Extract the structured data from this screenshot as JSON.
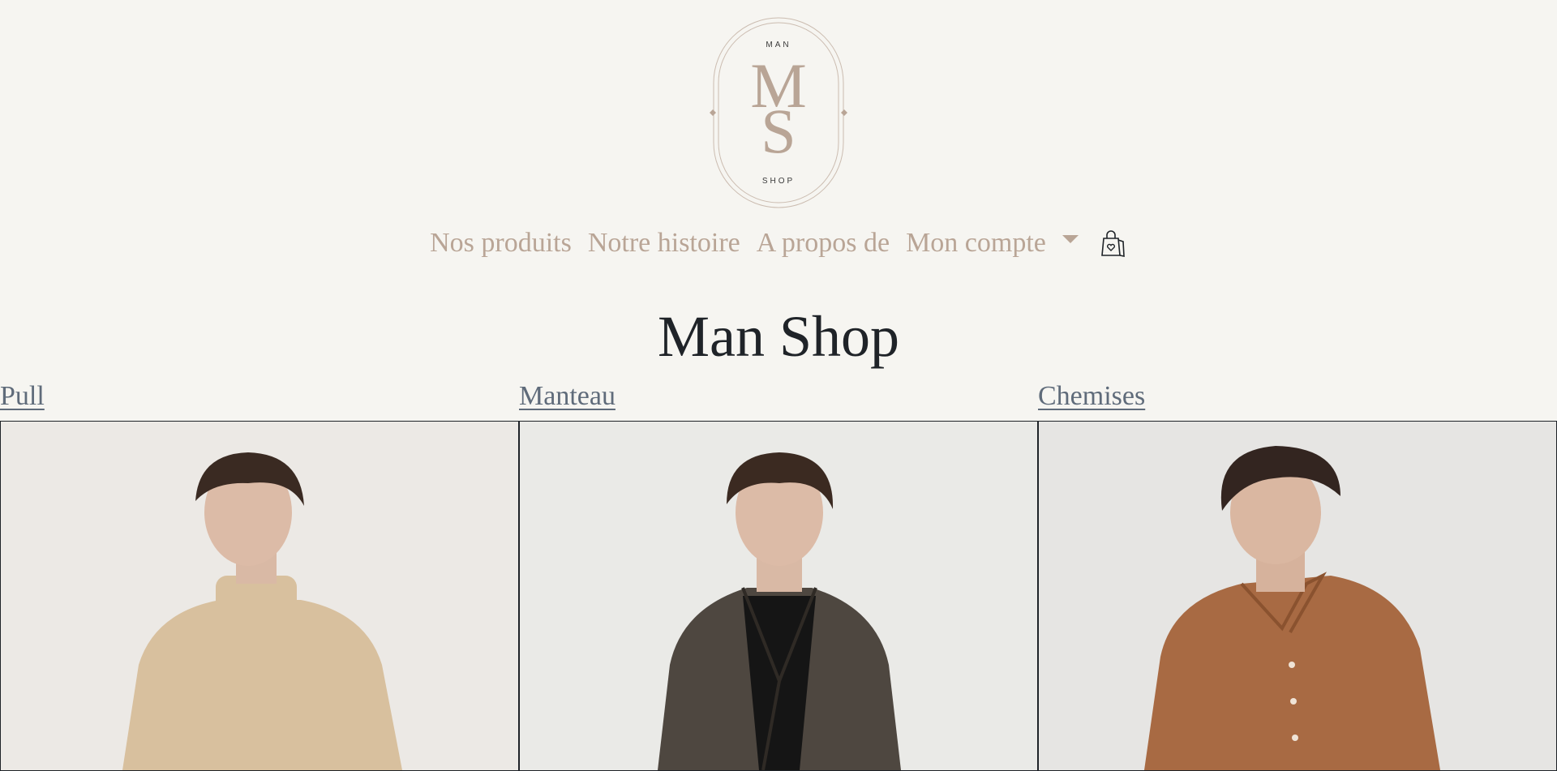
{
  "brand": {
    "logo_top": "MAN",
    "logo_m": "M",
    "logo_s": "S",
    "logo_bottom": "SHOP"
  },
  "nav": {
    "items": [
      {
        "label": "Nos produits"
      },
      {
        "label": "Notre histoire"
      },
      {
        "label": "A propos de"
      }
    ],
    "account_label": "Mon compte",
    "cart_icon": "shopping-bag-icon"
  },
  "page": {
    "title": "Man Shop"
  },
  "categories": [
    {
      "label": "Pull",
      "garment_color": "#d8c09e"
    },
    {
      "label": "Manteau",
      "garment_color": "#4e4740"
    },
    {
      "label": "Chemises",
      "garment_color": "#a86a43"
    }
  ],
  "colors": {
    "background": "#f6f5f1",
    "accent": "#b9a596",
    "title": "#1f2328",
    "link": "#5f6b7a"
  }
}
